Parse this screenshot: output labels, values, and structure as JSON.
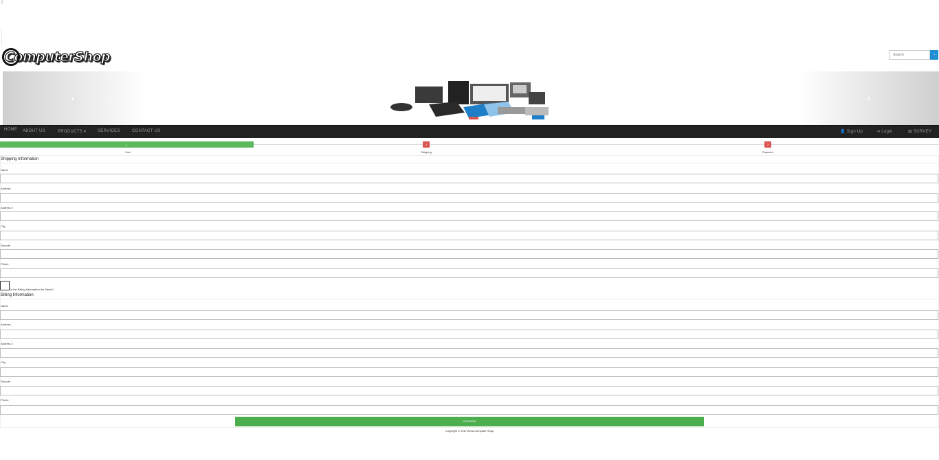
{
  "header": {
    "logo_text": "ComputerShop",
    "search": {
      "placeholder": "Search",
      "button_icon": "search-icon"
    }
  },
  "carousel": {
    "prev_icon": "chevron-left-icon",
    "next_icon": "chevron-right-icon"
  },
  "nav": {
    "home": "HOME",
    "about": "ABOUT US",
    "products": "PRODUCTS ▾",
    "services": "SERVICES",
    "contact": "CONTACT US",
    "signup": "Sign Up",
    "login": "Login",
    "survey": "SURVEY"
  },
  "progress": {
    "completed_fraction": 0.27,
    "steps": [
      {
        "number": "1",
        "label": "Cart"
      },
      {
        "number": "2",
        "label": "Shipping"
      },
      {
        "number": "3",
        "label": "Payment"
      }
    ]
  },
  "shipping": {
    "title": "Shipping Information",
    "fields": [
      "Name",
      "Address",
      "Address 2",
      "City",
      "Zipcode",
      "Phone"
    ]
  },
  "same_billing_label": "Is the Billing Information the Same?",
  "billing": {
    "title": "Billing Information",
    "fields": [
      "Name",
      "Address",
      "Address 2",
      "City",
      "Zipcode",
      "Phone"
    ]
  },
  "confirm_label": "CONFIRM",
  "footer": {
    "copyright": "Copyright © 2017 Alma Computer Shop"
  },
  "colors": {
    "progress": "#5cb85c",
    "badge": "#d9534f",
    "navbar": "#222222",
    "confirm": "#4cae4c",
    "search_button": "#1e8fd0"
  }
}
